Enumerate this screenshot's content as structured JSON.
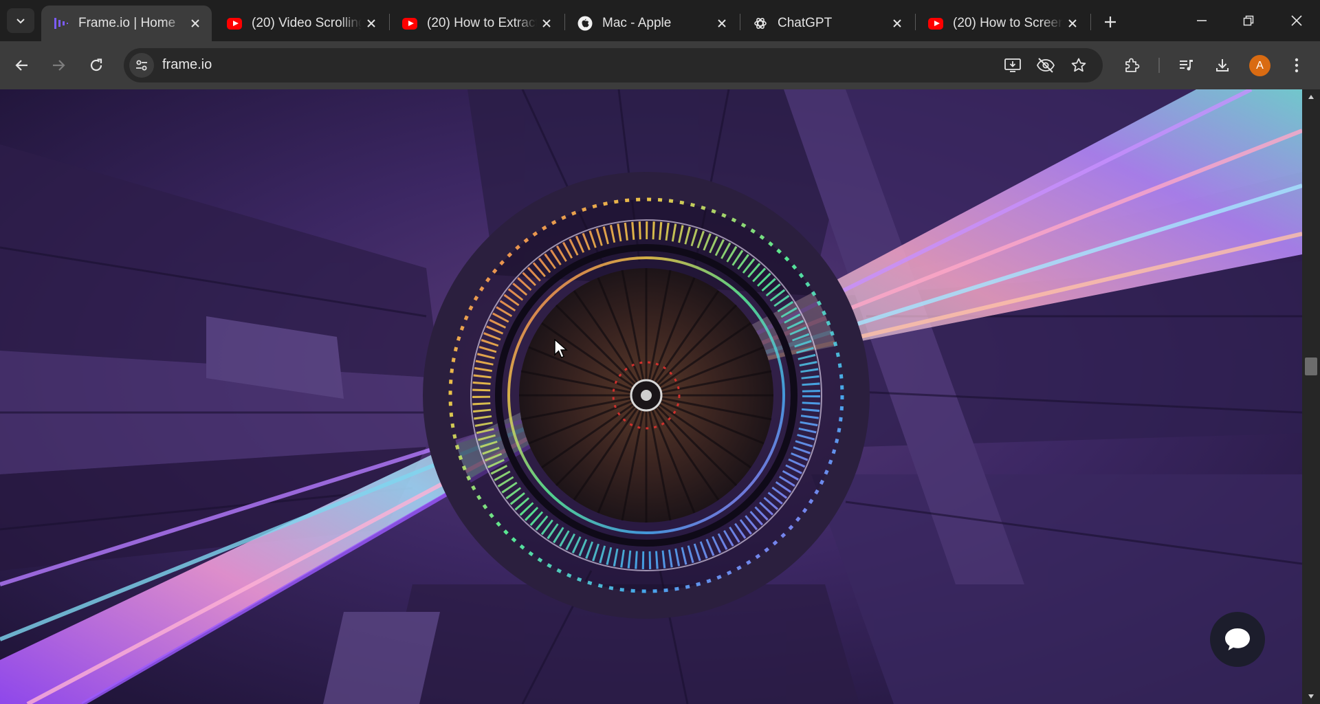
{
  "browser": {
    "tabs": [
      {
        "title": "Frame.io | Home",
        "favicon": "frameio-icon",
        "active": true
      },
      {
        "title": "(20) Video Scrolling",
        "favicon": "youtube-icon",
        "active": false
      },
      {
        "title": "(20) How to Extract",
        "favicon": "youtube-icon",
        "active": false
      },
      {
        "title": "Mac - Apple",
        "favicon": "apple-icon",
        "active": false
      },
      {
        "title": "ChatGPT",
        "favicon": "chatgpt-icon",
        "active": false
      },
      {
        "title": "(20) How to Screen",
        "favicon": "youtube-icon",
        "active": false
      }
    ],
    "address": {
      "url": "frame.io"
    },
    "profile_initial": "A",
    "colors": {
      "avatar": "#d96b12",
      "toolbar": "#3c3c3c",
      "tabstrip": "#1f1f1f",
      "accent_purple": "#7b5cff"
    }
  },
  "page": {
    "hero_image": "purple futuristic tunnel with iridescent circular portal and neon light streaks",
    "chat_widget": "chat-bubble-icon"
  }
}
